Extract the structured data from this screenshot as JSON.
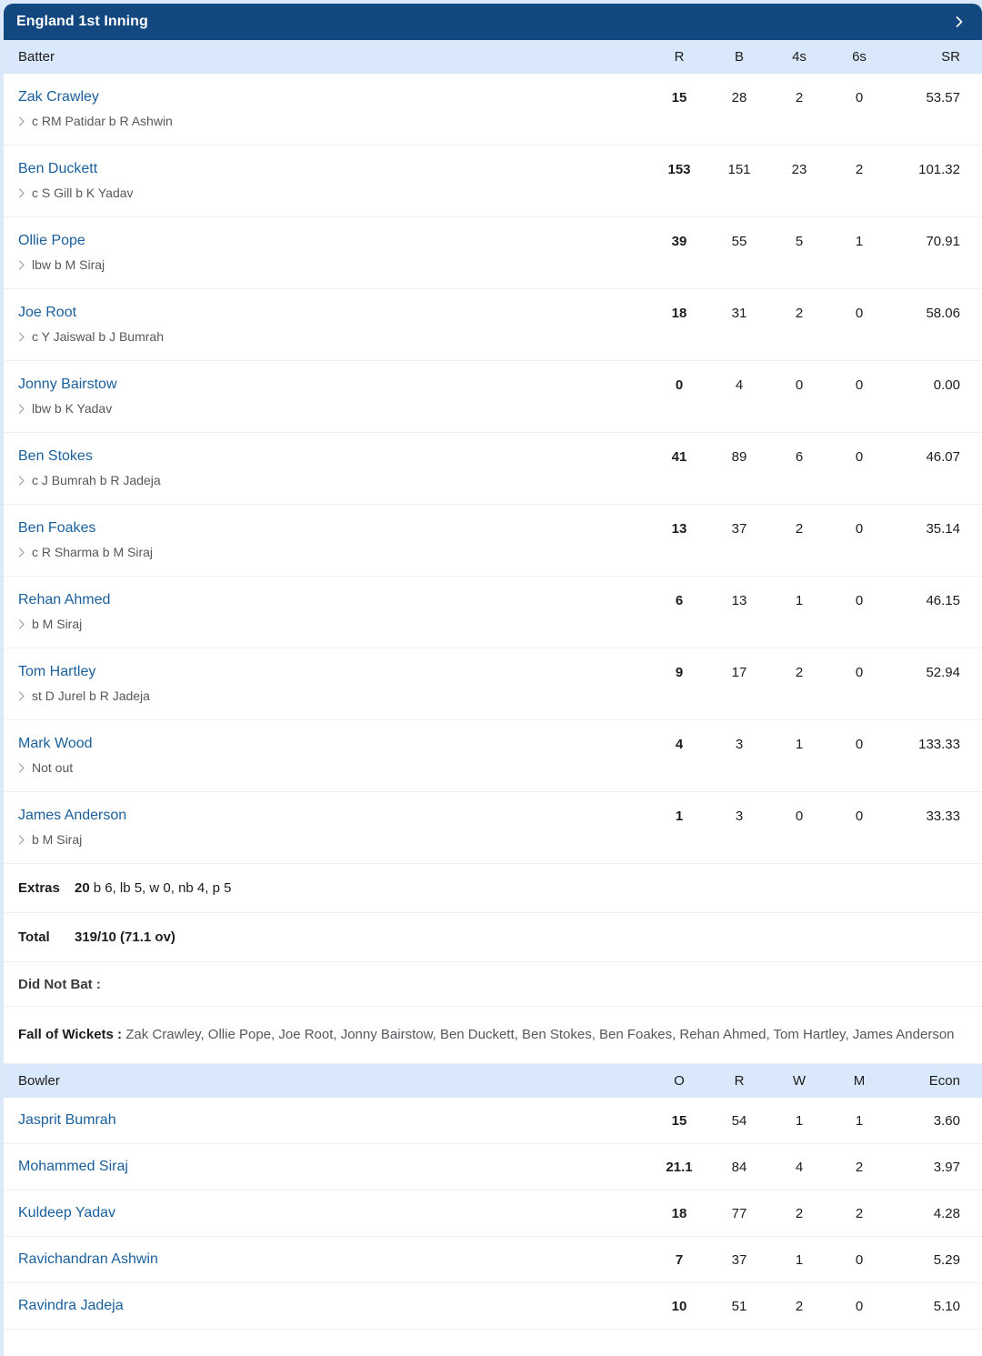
{
  "header": {
    "title": "England 1st Inning",
    "expand_icon": "chevron-right-icon"
  },
  "batting": {
    "columns": {
      "name": "Batter",
      "r": "R",
      "b": "B",
      "fours": "4s",
      "sixes": "6s",
      "sr": "SR"
    },
    "rows": [
      {
        "name": "Zak Crawley",
        "dismissal": "c RM Patidar b R Ashwin",
        "r": "15",
        "b": "28",
        "fours": "2",
        "sixes": "0",
        "sr": "53.57"
      },
      {
        "name": "Ben Duckett",
        "dismissal": "c S Gill b K Yadav",
        "r": "153",
        "b": "151",
        "fours": "23",
        "sixes": "2",
        "sr": "101.32"
      },
      {
        "name": "Ollie Pope",
        "dismissal": "lbw b M Siraj",
        "r": "39",
        "b": "55",
        "fours": "5",
        "sixes": "1",
        "sr": "70.91"
      },
      {
        "name": "Joe Root",
        "dismissal": "c Y Jaiswal b J Bumrah",
        "r": "18",
        "b": "31",
        "fours": "2",
        "sixes": "0",
        "sr": "58.06"
      },
      {
        "name": "Jonny Bairstow",
        "dismissal": "lbw b K Yadav",
        "r": "0",
        "b": "4",
        "fours": "0",
        "sixes": "0",
        "sr": "0.00"
      },
      {
        "name": "Ben Stokes",
        "dismissal": "c J Bumrah b R Jadeja",
        "r": "41",
        "b": "89",
        "fours": "6",
        "sixes": "0",
        "sr": "46.07"
      },
      {
        "name": "Ben Foakes",
        "dismissal": "c R Sharma b M Siraj",
        "r": "13",
        "b": "37",
        "fours": "2",
        "sixes": "0",
        "sr": "35.14"
      },
      {
        "name": "Rehan Ahmed",
        "dismissal": "b M Siraj",
        "r": "6",
        "b": "13",
        "fours": "1",
        "sixes": "0",
        "sr": "46.15"
      },
      {
        "name": "Tom Hartley",
        "dismissal": "st D Jurel b R Jadeja",
        "r": "9",
        "b": "17",
        "fours": "2",
        "sixes": "0",
        "sr": "52.94"
      },
      {
        "name": "Mark Wood",
        "dismissal": "Not out",
        "r": "4",
        "b": "3",
        "fours": "1",
        "sixes": "0",
        "sr": "133.33"
      },
      {
        "name": "James Anderson",
        "dismissal": "b M Siraj",
        "r": "1",
        "b": "3",
        "fours": "0",
        "sixes": "0",
        "sr": "33.33"
      }
    ]
  },
  "summary": {
    "extras_label": "Extras",
    "extras_total": "20",
    "extras_breakdown": "b 6, lb 5, w 0, nb 4, p 5",
    "total_label": "Total",
    "total_value": "319/10 (71.1 ov)",
    "did_not_bat_label": "Did Not Bat :",
    "did_not_bat_value": "",
    "fall_of_wickets_label": "Fall of Wickets :",
    "fall_of_wickets_value": "Zak Crawley, Ollie Pope, Joe Root, Jonny Bairstow, Ben Duckett, Ben Stokes, Ben Foakes, Rehan Ahmed, Tom Hartley, James Anderson"
  },
  "bowling": {
    "columns": {
      "name": "Bowler",
      "o": "O",
      "r": "R",
      "w": "W",
      "m": "M",
      "econ": "Econ"
    },
    "rows": [
      {
        "name": "Jasprit Bumrah",
        "o": "15",
        "r": "54",
        "w": "1",
        "m": "1",
        "econ": "3.60"
      },
      {
        "name": "Mohammed Siraj",
        "o": "21.1",
        "r": "84",
        "w": "4",
        "m": "2",
        "econ": "3.97"
      },
      {
        "name": "Kuldeep Yadav",
        "o": "18",
        "r": "77",
        "w": "2",
        "m": "2",
        "econ": "4.28"
      },
      {
        "name": "Ravichandran Ashwin",
        "o": "7",
        "r": "37",
        "w": "1",
        "m": "0",
        "econ": "5.29"
      },
      {
        "name": "Ravindra Jadeja",
        "o": "10",
        "r": "51",
        "w": "2",
        "m": "0",
        "econ": "5.10"
      }
    ]
  },
  "colors": {
    "header_blue": "#12477f",
    "column_header_blue": "#d9e9fb",
    "link_blue": "#1a5f9c",
    "page_background": "#dce9fa"
  }
}
